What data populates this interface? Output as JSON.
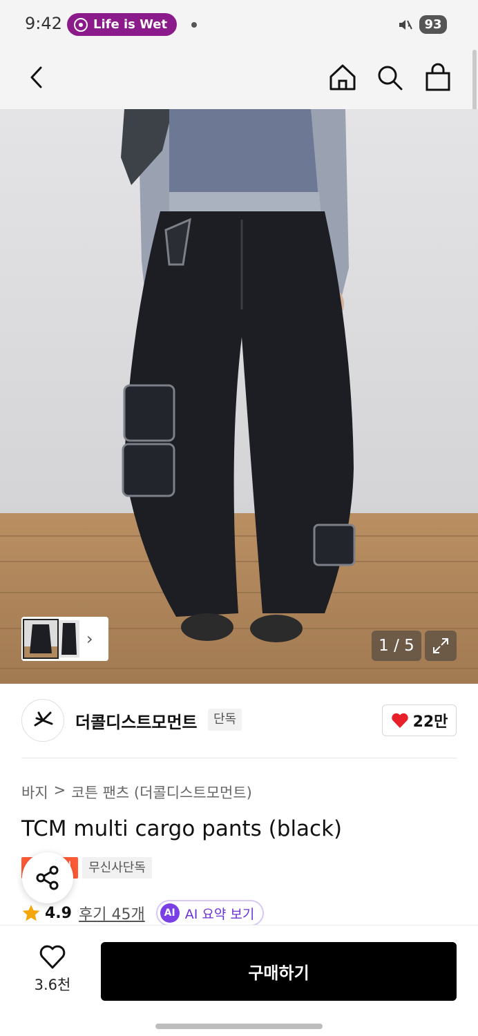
{
  "status_bar": {
    "time": "9:42",
    "media_title": "Life is Wet",
    "battery": "93"
  },
  "nav": {
    "icons": [
      "back-icon",
      "home-icon",
      "search-icon",
      "shopping-bag-icon"
    ]
  },
  "gallery": {
    "indicator": "1 / 5",
    "current_page": 1,
    "total_pages": 5
  },
  "brand": {
    "name": "더콜디스트모먼트",
    "tag": "단독",
    "likes": "22만"
  },
  "product": {
    "breadcrumb": [
      "바지",
      ">",
      "코튼 팬츠 (더콜디스트모먼트)"
    ],
    "title": "TCM multi cargo pants (black)",
    "badges": [
      "세일",
      "무신사단독"
    ],
    "rating": "4.9",
    "reviews": "후기 45개",
    "ai_mark": "AI",
    "ai_label": "AI 요약 보기"
  },
  "bottom_bar": {
    "wish_count": "3.6천",
    "buy_label": "구매하기"
  },
  "colors": {
    "media_pill": "#8b1a8a",
    "sale_badge": "#ff5a36",
    "heart": "#e8202a",
    "star": "#f4a60b",
    "ai_accent": "#7a40e6",
    "buy_button": "#000000"
  }
}
